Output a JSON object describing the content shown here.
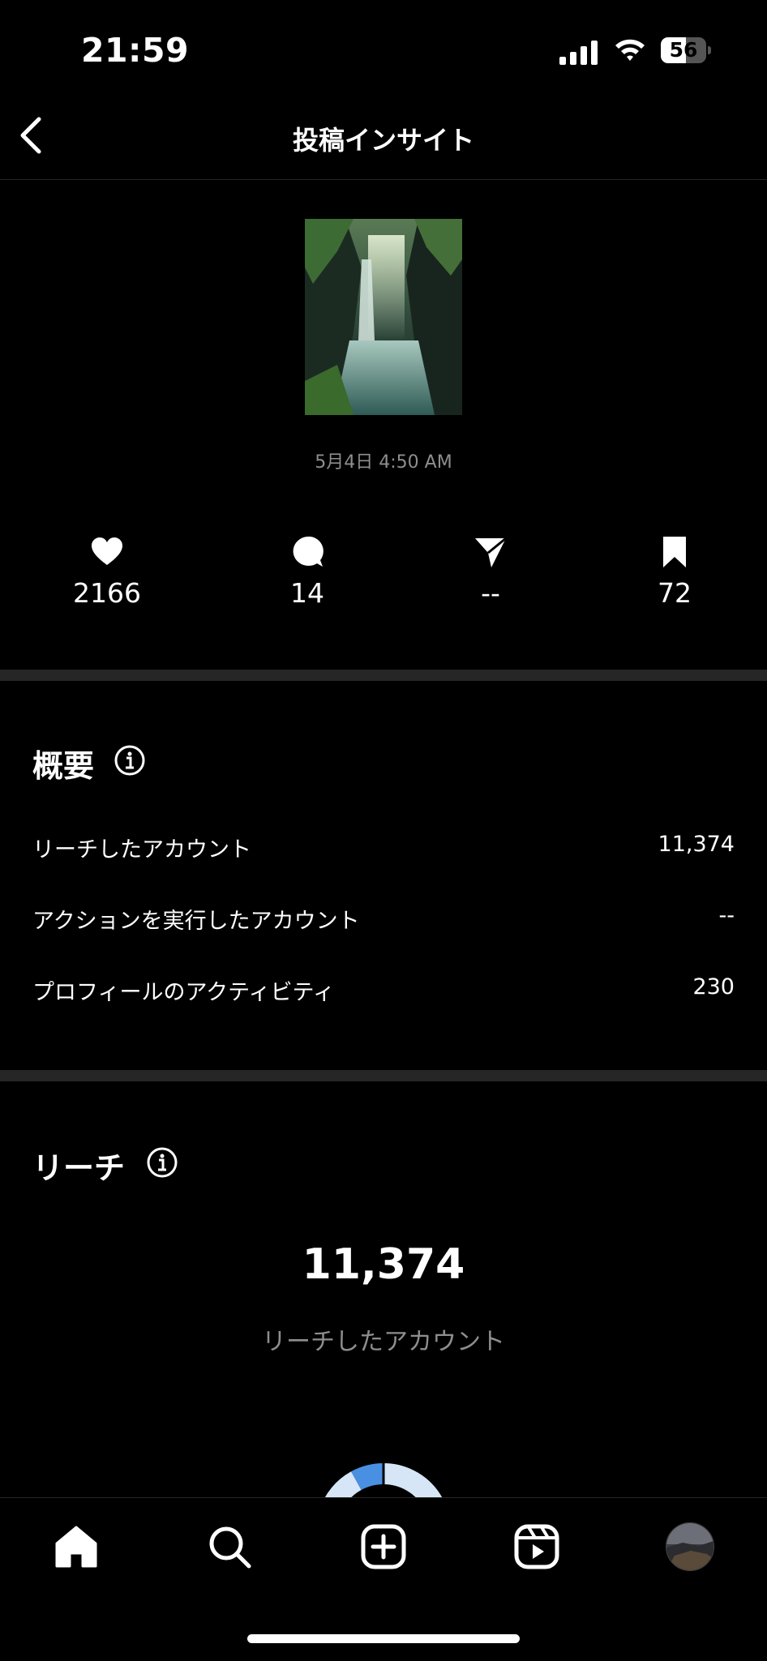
{
  "status_bar": {
    "time": "21:59",
    "battery": 56
  },
  "header": {
    "title": "投稿インサイト"
  },
  "post": {
    "date": "5月4日 4:50 AM"
  },
  "metrics": [
    {
      "icon": "heart-icon",
      "value": "2166"
    },
    {
      "icon": "comment-icon",
      "value": "14"
    },
    {
      "icon": "share-icon",
      "value": "--"
    },
    {
      "icon": "bookmark-icon",
      "value": "72"
    }
  ],
  "overview": {
    "title": "概要",
    "rows": [
      {
        "label": "リーチしたアカウント",
        "value": "11,374"
      },
      {
        "label": "アクションを実行したアカウント",
        "value": "--"
      },
      {
        "label": "プロフィールのアクティビティ",
        "value": "230"
      }
    ]
  },
  "reach": {
    "title": "リーチ",
    "total": "11,374",
    "subtitle": "リーチしたアカウント",
    "donut": {
      "segments": [
        {
          "color": "#4a90e2",
          "fraction": 0.08
        },
        {
          "color": "#d6e6f7",
          "fraction": 0.92
        }
      ]
    }
  },
  "nav": {
    "items": [
      {
        "icon": "home-icon"
      },
      {
        "icon": "search-icon"
      },
      {
        "icon": "create-icon"
      },
      {
        "icon": "reels-icon"
      },
      {
        "icon": "profile-avatar"
      }
    ]
  }
}
